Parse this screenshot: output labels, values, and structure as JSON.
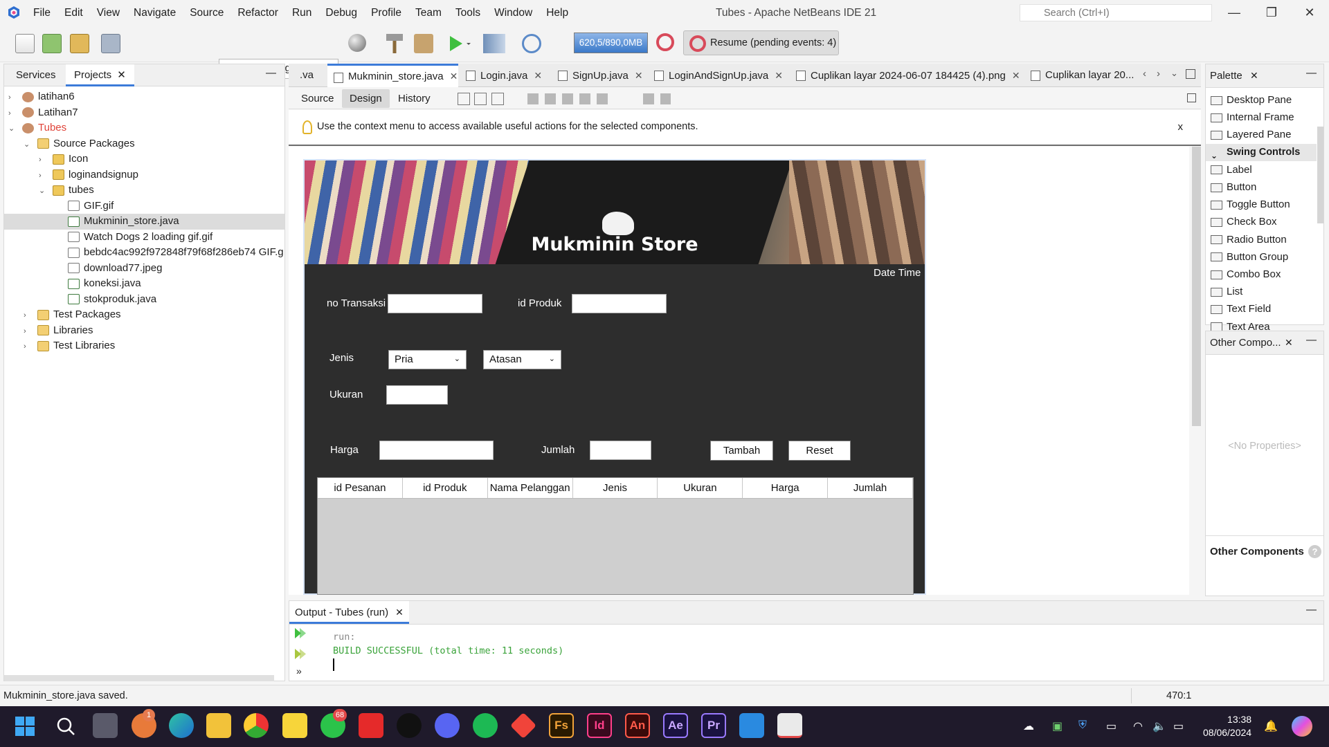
{
  "window": {
    "title": "Tubes - Apache NetBeans IDE 21",
    "search_placeholder": "Search (Ctrl+I)"
  },
  "menu": [
    "File",
    "Edit",
    "View",
    "Navigate",
    "Source",
    "Refactor",
    "Run",
    "Debug",
    "Profile",
    "Team",
    "Tools",
    "Window",
    "Help"
  ],
  "toolbar": {
    "config": "<default config>",
    "memory": "620,5/890,0MB",
    "resume": "Resume (pending events: 4)"
  },
  "left_panel": {
    "tabs": [
      "Services",
      "Projects"
    ],
    "tree": [
      {
        "label": "latihan6",
        "icon": "project-icon"
      },
      {
        "label": "Latihan7",
        "icon": "project-icon"
      },
      {
        "label": "Tubes",
        "icon": "project-icon"
      },
      {
        "label": "Source Packages",
        "icon": "folder-icon"
      },
      {
        "label": "Icon",
        "icon": "package-icon"
      },
      {
        "label": "loginandsignup",
        "icon": "package-icon"
      },
      {
        "label": "tubes",
        "icon": "package-icon"
      },
      {
        "label": "GIF.gif",
        "icon": "file-icon"
      },
      {
        "label": "Mukminin_store.java",
        "icon": "java-file-icon"
      },
      {
        "label": "Watch Dogs 2 loading gif.gif",
        "icon": "file-icon"
      },
      {
        "label": "bebdc4ac992f972848f79f68f286eb74 GIF.g",
        "icon": "file-icon"
      },
      {
        "label": "download77.jpeg",
        "icon": "file-icon"
      },
      {
        "label": "koneksi.java",
        "icon": "java-file-icon"
      },
      {
        "label": "stokproduk.java",
        "icon": "java-file-icon"
      },
      {
        "label": "Test Packages",
        "icon": "folder-icon"
      },
      {
        "label": "Libraries",
        "icon": "folder-icon"
      },
      {
        "label": "Test Libraries",
        "icon": "folder-icon"
      }
    ],
    "tree_toggles": [
      "›",
      "›",
      "⌄",
      "⌄",
      "›",
      "›",
      "⌄",
      "",
      "",
      "",
      "",
      "",
      "",
      "",
      "›",
      "›",
      "›"
    ]
  },
  "editor": {
    "tabs": [
      ".va",
      "Mukminin_store.java",
      "Login.java",
      "SignUp.java",
      "LoginAndSignUp.java",
      "Cuplikan layar 2024-06-07 184425 (4).png",
      "Cuplikan layar 20..."
    ],
    "design_tabs": [
      "Source",
      "Design",
      "History"
    ],
    "hint": "Use the context menu to access available useful actions for the selected components.",
    "hint_close": "x"
  },
  "form": {
    "title": "Mukminin Store",
    "datetime": "Date Time",
    "no_transaksi_label": "no Transaksi",
    "id_produk_label": "id Produk",
    "jenis_label": "Jenis",
    "jenis_value": "Pria",
    "kategori_value": "Atasan",
    "ukuran_label": "Ukuran",
    "harga_label": "Harga",
    "jumlah_label": "Jumlah",
    "tambah_button": "Tambah",
    "reset_button": "Reset",
    "table_columns": [
      "id Pesanan",
      "id Produk",
      "Nama Pelanggan",
      "Jenis",
      "Ukuran",
      "Harga",
      "Jumlah"
    ]
  },
  "palette": {
    "title": "Palette",
    "items": [
      "Desktop Pane",
      "Internal Frame",
      "Layered Pane",
      "Swing Controls",
      "Label",
      "Button",
      "Toggle Button",
      "Check Box",
      "Radio Button",
      "Button Group",
      "Combo Box",
      "List",
      "Text Field",
      "Text Area"
    ]
  },
  "properties": {
    "title": "Other Compo...",
    "empty": "<No Properties>",
    "other_components": "Other Components"
  },
  "output": {
    "title": "Output - Tubes (run)",
    "line1": "run:",
    "line2": "BUILD SUCCESSFUL (total time: 11 seconds)"
  },
  "status": {
    "message": "Mukminin_store.java saved.",
    "position": "470:1"
  },
  "taskbar": {
    "time": "13:38",
    "date": "08/06/2024",
    "whatsapp_badge": "68",
    "apps": [
      "Fs",
      "Id",
      "An",
      "Ae",
      "Pr"
    ]
  }
}
